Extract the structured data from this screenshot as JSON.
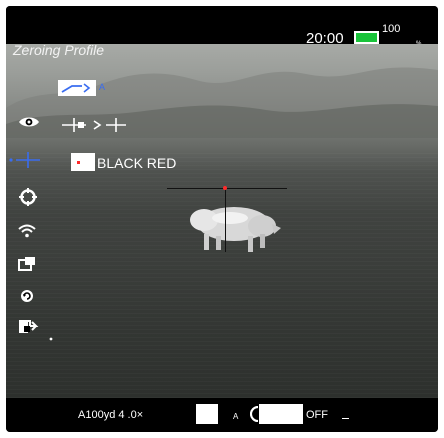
{
  "status": {
    "time": "20:00",
    "battery_percent": "100",
    "battery_unit": "%",
    "battery_level": 1.0,
    "battery_color": "#19c43a"
  },
  "overlay": {
    "title": "Zeroing Profile"
  },
  "menu": {
    "items": [
      {
        "icon": "eye-icon"
      },
      {
        "icon": "crosshair-icon"
      },
      {
        "icon": "reticle-settings-icon"
      },
      {
        "icon": "wifi-icon"
      },
      {
        "icon": "picture-in-picture-icon"
      },
      {
        "icon": "refresh-icon"
      },
      {
        "icon": "export-icon"
      }
    ],
    "selected_index": 1
  },
  "rows": {
    "reticle_arrow": ">",
    "reticle_color": "BLACK RED"
  },
  "bottom": {
    "zoom": "A100yd 4 .0×",
    "mode_letter": "A",
    "recording_state": "OFF"
  },
  "colors": {
    "accent": "#3a6df0",
    "dot": "#ff2a2a"
  }
}
